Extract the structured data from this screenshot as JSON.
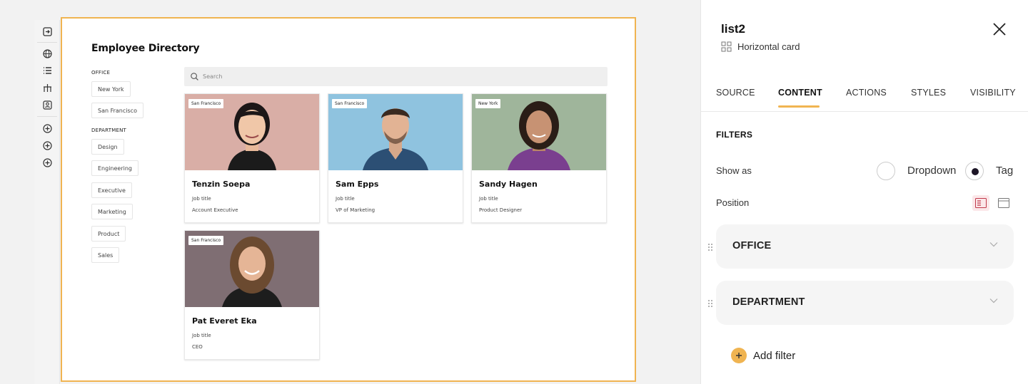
{
  "toolbar": {
    "icons": [
      "enter-icon",
      "globe-icon",
      "list-icon",
      "tree-icon",
      "contact-icon",
      "add-circle-icon",
      "add-circle-icon",
      "add-circle-icon"
    ]
  },
  "canvas": {
    "title": "Employee Directory",
    "office_label": "OFFICE",
    "office_tags": [
      "New York",
      "San Francisco"
    ],
    "department_label": "DEPARTMENT",
    "department_tags": [
      "Design",
      "Engineering",
      "Executive",
      "Marketing",
      "Product",
      "Sales"
    ],
    "search_placeholder": "Search",
    "cards": [
      {
        "location": "San Francisco",
        "name": "Tenzin Soepa",
        "job_label": "Job title",
        "role": "Account Executive"
      },
      {
        "location": "San Francisco",
        "name": "Sam Epps",
        "job_label": "Job title",
        "role": "VP of Marketing"
      },
      {
        "location": "New York",
        "name": "Sandy Hagen",
        "job_label": "Job title",
        "role": "Product Designer"
      },
      {
        "location": "San Francisco",
        "name": "Pat Everet Eka",
        "job_label": "Job title",
        "role": "CEO"
      }
    ]
  },
  "panel": {
    "title": "list2",
    "subtitle": "Horizontal card",
    "tabs": [
      "SOURCE",
      "CONTENT",
      "ACTIONS",
      "STYLES",
      "VISIBILITY"
    ],
    "active_tab": "CONTENT",
    "filters_label": "FILTERS",
    "show_as_label": "Show as",
    "show_as_options": [
      "Dropdown",
      "Tag"
    ],
    "show_as_selected": "Tag",
    "position_label": "Position",
    "filters": [
      "OFFICE",
      "DEPARTMENT"
    ],
    "add_filter_label": "Add filter"
  },
  "colors": {
    "accent": "#f0b451",
    "radio_dot": "#1c1526",
    "photo_bg_1": "#d9aea6",
    "photo_bg_2": "#8fc3df",
    "photo_bg_3": "#9fb59b",
    "photo_bg_4": "#7f6e73"
  }
}
